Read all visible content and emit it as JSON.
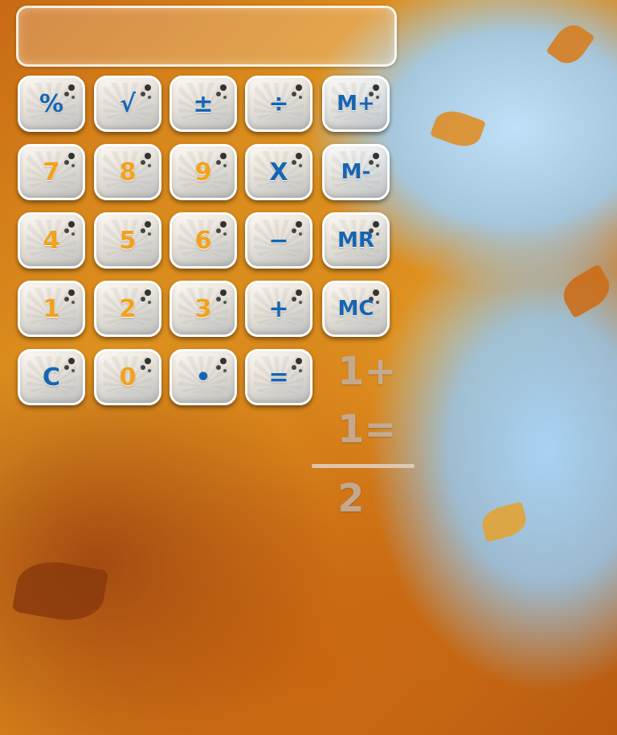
{
  "display": {
    "value": ""
  },
  "keypad": {
    "rows": [
      [
        {
          "label": "%",
          "color": "blue"
        },
        {
          "label": "√",
          "color": "blue"
        },
        {
          "label": "±",
          "color": "blue"
        },
        {
          "label": "÷",
          "color": "blue"
        },
        {
          "label": "M+",
          "color": "blue"
        }
      ],
      [
        {
          "label": "7",
          "color": "orange"
        },
        {
          "label": "8",
          "color": "orange"
        },
        {
          "label": "9",
          "color": "orange"
        },
        {
          "label": "X",
          "color": "blue"
        },
        {
          "label": "M-",
          "color": "blue"
        }
      ],
      [
        {
          "label": "4",
          "color": "orange"
        },
        {
          "label": "5",
          "color": "orange"
        },
        {
          "label": "6",
          "color": "orange"
        },
        {
          "label": "−",
          "color": "blue"
        },
        {
          "label": "MR",
          "color": "blue"
        }
      ],
      [
        {
          "label": "1",
          "color": "orange"
        },
        {
          "label": "2",
          "color": "orange"
        },
        {
          "label": "3",
          "color": "orange"
        },
        {
          "label": "+",
          "color": "blue"
        },
        {
          "label": "MC",
          "color": "blue"
        }
      ],
      [
        {
          "label": "C",
          "color": "blue"
        },
        {
          "label": "0",
          "color": "orange"
        },
        {
          "label": "•",
          "color": "blue"
        },
        {
          "label": "=",
          "color": "blue"
        }
      ]
    ]
  },
  "hint": {
    "line1": "1+",
    "line2": "1=",
    "result": "2"
  },
  "colors": {
    "blue": "#1765b0",
    "orange": "#f2a21c"
  }
}
